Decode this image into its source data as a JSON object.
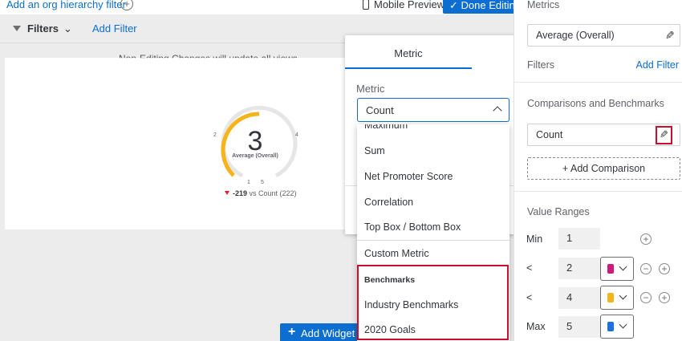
{
  "topbar": {
    "org_filter_link": "Add an org hierarchy filter",
    "plus_glyph": "+",
    "mobile_preview": "Mobile Preview",
    "done_editing": "Done Editing"
  },
  "filterbar": {
    "filters_label": "Filters",
    "chevron": "⌄",
    "add_filter": "Add Filter"
  },
  "canvas": {
    "note": "Non-Editing Changes will update all views",
    "add_widget": "Add Widget",
    "add_widget_plus": "+"
  },
  "gauge": {
    "value_text": "3",
    "value": 3,
    "min": 1,
    "max": 5,
    "label": "Average (Overall)",
    "ticks": [
      "2",
      "4",
      "1",
      "5"
    ],
    "color_filled": "#f5b419",
    "color_empty": "#e6e6e6",
    "delta": "-219",
    "delta_suffix": "vs Count (222)"
  },
  "popup": {
    "tab_metric": "Metric",
    "metric_label": "Metric",
    "metric_value": "Count"
  },
  "dropdown": {
    "items": [
      "Maximum",
      "Sum",
      "Net Promoter Score",
      "Correlation",
      "Top Box / Bottom Box",
      "Custom Metric"
    ],
    "benchmarks_header": "Benchmarks",
    "benchmark_items": [
      "Industry Benchmarks",
      "2020 Goals"
    ]
  },
  "panel": {
    "metrics_label": "Metrics",
    "metrics_value": "Average (Overall)",
    "filters_label": "Filters",
    "add_filter": "Add Filter",
    "comparisons_label": "Comparisons and Benchmarks",
    "comparison_value": "Count",
    "add_comparison": "+ Add Comparison",
    "value_ranges_label": "Value Ranges",
    "pencil_glyph": "✎",
    "ranges": [
      {
        "label": "Min",
        "value": "1",
        "color": null
      },
      {
        "label": "<",
        "value": "2",
        "color": "#d1187b"
      },
      {
        "label": "<",
        "value": "4",
        "color": "#f5b419"
      },
      {
        "label": "Max",
        "value": "5",
        "color": "#1d6fe3"
      }
    ],
    "minus_glyph": "−",
    "plus_glyph": "+"
  }
}
